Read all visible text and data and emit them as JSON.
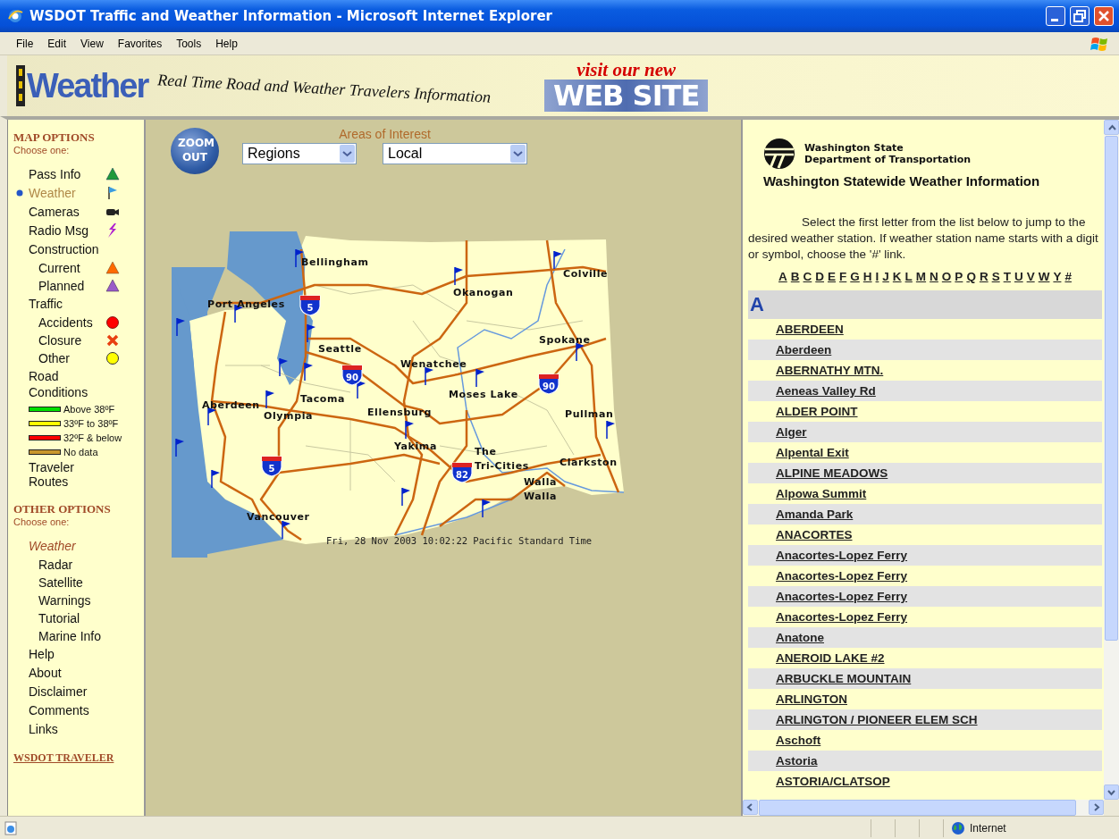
{
  "window": {
    "title": "WSDOT Traffic and Weather Information - Microsoft Internet Explorer"
  },
  "menu": [
    "File",
    "Edit",
    "View",
    "Favorites",
    "Tools",
    "Help"
  ],
  "banner": {
    "logo": "Weather",
    "tagline": "Real Time Road and Weather Travelers Information",
    "promo_top": "visit our new",
    "promo_bottom": "WEB SITE"
  },
  "map_options": {
    "title": "MAP OPTIONS",
    "hint": "Choose one:",
    "items": [
      {
        "kind": "option",
        "label": "Pass Info",
        "selected": false
      },
      {
        "kind": "option",
        "label": "Weather",
        "selected": true
      },
      {
        "kind": "option",
        "label": "Cameras",
        "selected": false
      },
      {
        "kind": "option",
        "label": "Radio Msg",
        "selected": false
      },
      {
        "kind": "group",
        "label": "Construction",
        "children": [
          {
            "kind": "option",
            "label": "Current",
            "selected": false
          },
          {
            "kind": "option",
            "label": "Planned",
            "selected": false
          }
        ]
      },
      {
        "kind": "group",
        "label": "Traffic",
        "children": [
          {
            "kind": "option",
            "label": "Accidents",
            "selected": false
          },
          {
            "kind": "option",
            "label": "Closure",
            "selected": false
          },
          {
            "kind": "option",
            "label": "Other",
            "selected": false
          }
        ]
      },
      {
        "kind": "group",
        "label": "Road Conditions",
        "children": [
          {
            "kind": "legend",
            "label": "Above 38ºF",
            "color": "#00e000"
          },
          {
            "kind": "legend",
            "label": "33ºF to 38ºF",
            "color": "#ffff00"
          },
          {
            "kind": "legend",
            "label": "32ºF & below",
            "color": "#ff0000"
          },
          {
            "kind": "legend",
            "label": "No data",
            "color": "#c8962d"
          }
        ]
      },
      {
        "kind": "option",
        "label": "Traveler Routes",
        "selected": false
      }
    ]
  },
  "other_options": {
    "title": "OTHER OPTIONS",
    "hint": "Choose one:",
    "items": [
      {
        "kind": "group",
        "label": "Weather",
        "children": [
          {
            "kind": "link",
            "label": "Radar"
          },
          {
            "kind": "link",
            "label": "Satellite"
          },
          {
            "kind": "link",
            "label": "Warnings"
          },
          {
            "kind": "link",
            "label": "Tutorial"
          },
          {
            "kind": "link",
            "label": "Marine Info"
          }
        ]
      },
      {
        "kind": "link",
        "label": "Help"
      },
      {
        "kind": "link",
        "label": "About"
      },
      {
        "kind": "link",
        "label": "Disclaimer"
      },
      {
        "kind": "link",
        "label": "Comments"
      },
      {
        "kind": "link",
        "label": "Links"
      }
    ]
  },
  "footer_link": "WSDOT TRAVELER",
  "zoom_button": "ZOOM OUT",
  "areas_of_interest": {
    "label": "Areas of Interest",
    "selects": [
      {
        "value": "Regions"
      },
      {
        "value": "Local"
      }
    ]
  },
  "map": {
    "cities": [
      "Bellingham",
      "Port Angeles",
      "Okanogan",
      "Colville",
      "Seattle",
      "Spokane",
      "Wenatchee",
      "Moses Lake",
      "Tacoma",
      "Aberdeen",
      "Olympia",
      "Ellensburg",
      "Pullman",
      "Yakima",
      "The",
      "Tri-Cities",
      "Clarkston",
      "Walla",
      "Walla",
      "Vancouver"
    ],
    "shields": [
      "5",
      "90",
      "90",
      "5",
      "82"
    ],
    "timestamp": "Fri, 28 Nov 2003   10:02:22 Pacific Standard Time"
  },
  "agency_name": [
    "Washington State",
    "Department of Transportation"
  ],
  "page_title": "Washington Statewide Weather Information",
  "intro": "Select the first letter from the list below to jump to the desired weather station. If weather station name starts with a digit or symbol, choose the '#' link.",
  "letters": [
    "A",
    "B",
    "C",
    "D",
    "E",
    "F",
    "G",
    "H",
    "I",
    "J",
    "K",
    "L",
    "M",
    "N",
    "O",
    "P",
    "Q",
    "R",
    "S",
    "T",
    "U",
    "V",
    "W",
    "Y",
    "#"
  ],
  "sections": [
    {
      "heading": "A",
      "stations": [
        "ABERDEEN",
        "Aberdeen",
        "ABERNATHY MTN.",
        "Aeneas Valley Rd",
        "ALDER POINT",
        "Alger",
        "Alpental Exit",
        "ALPINE MEADOWS",
        "Alpowa Summit",
        "Amanda Park",
        "ANACORTES",
        "Anacortes-Lopez Ferry",
        "Anacortes-Lopez Ferry",
        "Anacortes-Lopez Ferry",
        "Anacortes-Lopez Ferry",
        "Anatone",
        "ANEROID LAKE #2",
        "ARBUCKLE MOUNTAIN",
        "ARLINGTON",
        "ARLINGTON / PIONEER ELEM SCH",
        "Aschoft",
        "Astoria",
        "ASTORIA/CLATSOP"
      ]
    }
  ],
  "status_bar": {
    "zone": "Internet"
  }
}
